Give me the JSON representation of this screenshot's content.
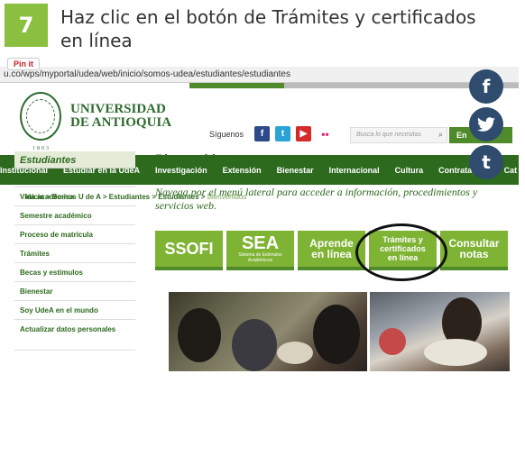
{
  "step": {
    "number": "7",
    "title": "Haz clic en el botón de Trámites y certificados en línea"
  },
  "pinit": "Pin it",
  "browser": {
    "url": "u.co/wps/myportal/udea/web/inicio/somos-udea/estudiantes/estudiantes"
  },
  "site": {
    "university_line1": "UNIVERSIDAD",
    "university_line2": "DE ANTIOQUIA",
    "seal_year": "1803",
    "siguenos": "Síguenos",
    "search_placeholder": "Busca lo que necesitas",
    "english_btn": "En",
    "nav": [
      "Institucional",
      "Estudiar en la UdeA",
      "Investigación",
      "Extensión",
      "Bienestar",
      "Internacional",
      "Cultura",
      "Contratación",
      "Cat"
    ],
    "breadcrumb": {
      "path": "Inicio > Somos U de A > Estudiantes > Estudiantes > ",
      "current": "Bienvenidos"
    },
    "sidebar": {
      "title": "Estudiantes",
      "items": [
        "Bienvenidos",
        "Vida académica",
        "Semestre académico",
        "Proceso de matrícula",
        "Trámites",
        "Becas y estímulos",
        "Bienestar",
        "Soy UdeA en el mundo",
        "Actualizar datos personales"
      ]
    },
    "main": {
      "title": "Bienvenidos",
      "description": "Navega por el menú lateral para acceder a información, procedimientos y servicios web."
    },
    "tiles": {
      "ssofi": "SSOFI",
      "sea": "SEA",
      "sea_sub": "Sistema de Estímulos Académicos",
      "aprende_1": "Aprende",
      "aprende_2": "en línea",
      "tramites_1": "Trámites y",
      "tramites_2": "certificados",
      "tramites_3": "en línea",
      "consultar_1": "Consultar",
      "consultar_2": "notas"
    }
  },
  "share": {
    "facebook": "f",
    "twitter": "t",
    "tumblr": "t"
  },
  "colors": {
    "accent_green": "#8bbf3f",
    "nav_green": "#2d6a1e",
    "tile_green": "#7fb334",
    "share_blue": "#2f4b6e"
  }
}
